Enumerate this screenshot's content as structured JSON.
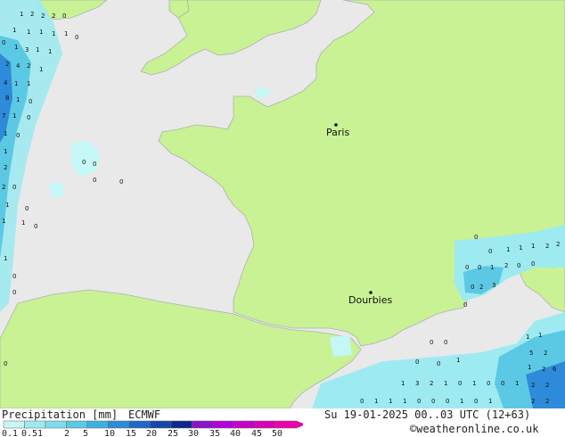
{
  "map": {
    "cities": [
      {
        "name": "Paris"
      },
      {
        "name": "Dourbies"
      }
    ],
    "colors": {
      "land": "#c8f294",
      "sea": "#e9e9ea",
      "coast": "#b0b0b0"
    }
  },
  "footer": {
    "title": "Precipitation [mm]",
    "model": "ECMWF",
    "datetime": "Su 19-01-2025 00..03 UTC (12+63)",
    "copyright": "©weatheronline.co.uk",
    "legend": {
      "ticks": [
        "0.1",
        "0.5",
        "1",
        "2",
        "5",
        "10",
        "15",
        "20",
        "25",
        "30",
        "35",
        "40",
        "45",
        "50"
      ],
      "colors": [
        "#c6f7f7",
        "#9eeaf1",
        "#7fdcec",
        "#5cc9e4",
        "#3db0df",
        "#2d8bd9",
        "#2066c8",
        "#1747a6",
        "#0d2a8a",
        "#8a14c8",
        "#b400d8",
        "#c400c4",
        "#d800b4",
        "#ea00a8"
      ]
    }
  }
}
